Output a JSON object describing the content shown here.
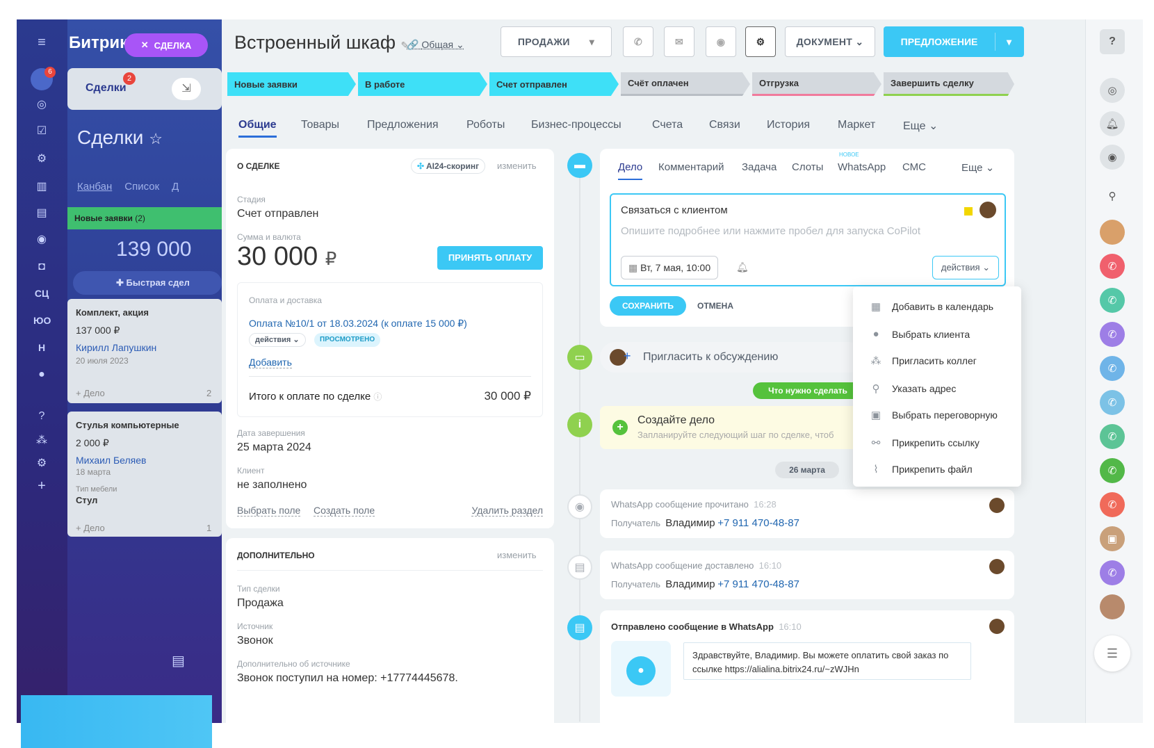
{
  "left_nav": {
    "badge_count": "6",
    "items": [
      "≡",
      "☰",
      "◎",
      "☑",
      "⚙",
      "▥",
      "▤",
      "◉",
      "◘"
    ],
    "labels": {
      "sc": "СЦ",
      "yu": "ЮО",
      "h": "Н"
    }
  },
  "kanban": {
    "app_name": "Битрикс",
    "close_chip": "СДЕЛКА",
    "tab_deals": "Сделки",
    "tab_badge": "2",
    "title": "Сделки",
    "view_kanban": "Канбан",
    "view_list": "Список",
    "view_more": "Д",
    "column_title": "Новые заявки",
    "column_count": "(2)",
    "column_sum": "139 000",
    "quick_deal": "Быстрая сдел",
    "cards": [
      {
        "title": "Комплект, акция",
        "sum": "137 000 ₽",
        "client": "Кирилл Лапушкин",
        "date": "20 июля 2023",
        "extra_label": "",
        "extra_value": "",
        "add": "+ Дело",
        "count": "2"
      },
      {
        "title": "Стулья компьютерные",
        "sum": "2 000 ₽",
        "client": "Михаил Беляев",
        "date": "18 марта",
        "extra_label": "Тип мебели",
        "extra_value": "Стул",
        "add": "+ Дело",
        "count": "1"
      }
    ]
  },
  "header": {
    "deal_title": "Встроенный шкаф",
    "access": "Общая",
    "sales_button": "ПРОДАЖИ",
    "document_button": "ДОКУМЕНТ",
    "proposal_button": "ПРЕДЛОЖЕНИЕ"
  },
  "stages": [
    "Новые заявки",
    "В работе",
    "Счет отправлен",
    "Счёт оплачен",
    "Отгрузка",
    "Завершить сделку"
  ],
  "tabs": [
    "Общие",
    "Товары",
    "Предложения",
    "Роботы",
    "Бизнес-процессы",
    "Счета",
    "Связи",
    "История",
    "Маркет",
    "Еще"
  ],
  "about": {
    "section_title": "О СДЕЛКЕ",
    "scoring": "AI24-скоринг",
    "edit": "изменить",
    "stage_label": "Стадия",
    "stage_value": "Счет отправлен",
    "sum_label": "Сумма и валюта",
    "sum_value": "30 000",
    "currency": "₽",
    "accept_payment": "ПРИНЯТЬ ОПЛАТУ",
    "payment_block_title": "Оплата и доставка",
    "payment_link": "Оплата №10/1 от 18.03.2024 (к оплате 15 000 ₽)",
    "actions_chip": "действия",
    "viewed_chip": "просмотрено",
    "add_link": "Добавить",
    "total_label": "Итого к оплате по сделке",
    "total_value": "30 000 ₽",
    "close_date_label": "Дата завершения",
    "close_date_value": "25 марта 2024",
    "client_label": "Клиент",
    "client_value": "не заполнено",
    "choose_field": "Выбрать поле",
    "create_field": "Создать поле",
    "delete_section": "Удалить раздел"
  },
  "additional": {
    "section_title": "ДОПОЛНИТЕЛЬНО",
    "edit": "изменить",
    "type_label": "Тип сделки",
    "type_value": "Продажа",
    "source_label": "Источник",
    "source_value": "Звонок",
    "source_more_label": "Дополнительно об источнике",
    "source_more_value": "Звонок поступил на номер: +17774445678."
  },
  "activity": {
    "tabs": [
      "Дело",
      "Комментарий",
      "Задача",
      "Слоты",
      "WhatsApp",
      "СМС",
      "Еще"
    ],
    "new_badge": "НОВОЕ",
    "todo_title": "Связаться с клиентом",
    "todo_placeholder": "Опишите подробнее или нажмите пробел для запуска CoPilot",
    "date_chip": "Вт, 7 мая, 10:00",
    "actions_button": "действия",
    "save": "СОХРАНИТЬ",
    "cancel": "ОТМЕНА"
  },
  "actions_menu": [
    "Добавить в календарь",
    "Выбрать клиента",
    "Пригласить коллег",
    "Указать адрес",
    "Выбрать переговорную",
    "Прикрепить ссылку",
    "Прикрепить файл"
  ],
  "timeline": {
    "invite": "Пригласить к обсуждению",
    "todo_badge": "Что нужно сделать",
    "create_title": "Создайте дело",
    "create_sub": "Запланируйте следующий шаг по сделке, чтоб",
    "date_sep": "26 марта",
    "events": [
      {
        "title": "WhatsApp сообщение прочитано",
        "time": "16:28",
        "recipient_label": "Получатель",
        "name": "Владимир",
        "phone": "+7 911 470-48-87"
      },
      {
        "title": "WhatsApp сообщение доставлено",
        "time": "16:10",
        "recipient_label": "Получатель",
        "name": "Владимир",
        "phone": "+7 911 470-48-87"
      }
    ],
    "sent_title": "Отправлено сообщение в WhatsApp",
    "sent_time": "16:10",
    "message": "Здравствуйте, Владимир. Вы можете оплатить свой заказ по ссылке https://alialina.bitrix24.ru/~zWJHn"
  }
}
